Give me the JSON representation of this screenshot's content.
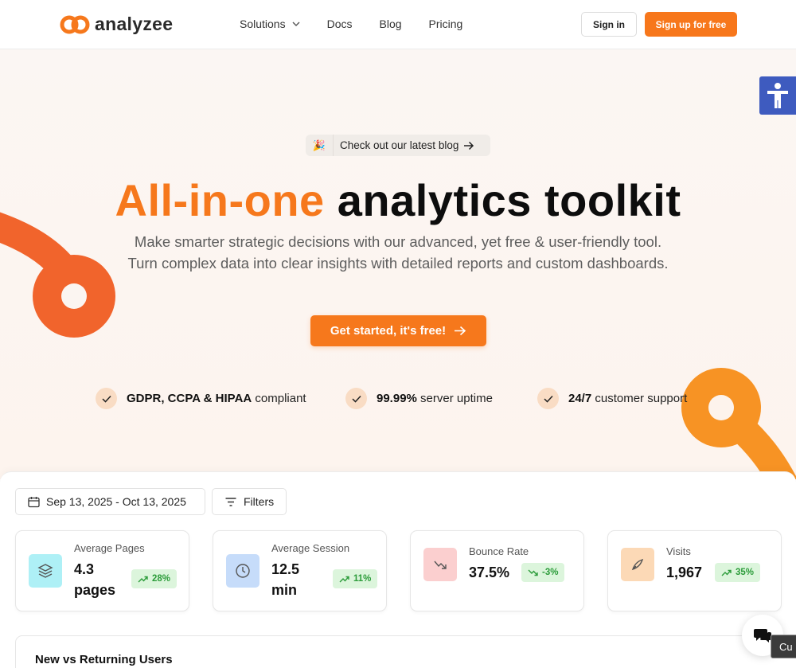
{
  "brand": {
    "name": "analyzee",
    "accent": "#f6781c"
  },
  "nav": {
    "items": [
      "Solutions",
      "Docs",
      "Blog",
      "Pricing"
    ]
  },
  "auth": {
    "sign_in": "Sign in",
    "sign_up": "Sign up for free"
  },
  "hero": {
    "pill_emoji": "🎉",
    "pill_text": "Check out our latest blog",
    "headline_accent": "All-in-one",
    "headline_rest": "analytics toolkit",
    "subtitle_line1": "Make smarter strategic decisions with our advanced, yet free & user-friendly tool.",
    "subtitle_line2": "Turn complex data into clear insights with detailed reports and custom dashboards.",
    "cta": "Get started, it's free!",
    "features": [
      {
        "bold": "GDPR, CCPA & HIPAA",
        "rest": " compliant"
      },
      {
        "bold": "99.99%",
        "rest": " server uptime"
      },
      {
        "bold": "24/7",
        "rest": " customer support"
      }
    ]
  },
  "dashboard": {
    "date_range": "Sep 13, 2025 - Oct 13, 2025",
    "filters_label": "Filters",
    "cards": [
      {
        "label": "Average Pages",
        "value_line1": "4.3",
        "value_line2": "pages",
        "change": "28%",
        "trend": "up",
        "icon": "layers-icon",
        "icon_bg": "#aef0f6"
      },
      {
        "label": "Average Session",
        "value_line1": "12.5",
        "value_line2": "min",
        "change": "11%",
        "trend": "up",
        "icon": "clock-icon",
        "icon_bg": "#c6dcfa"
      },
      {
        "label": "Bounce Rate",
        "value_line1": "37.5%",
        "value_line2": "",
        "change": "-3%",
        "trend": "down",
        "icon": "bounce-arrow-icon",
        "icon_bg": "#fbcfcf"
      },
      {
        "label": "Visits",
        "value_line1": "1,967",
        "value_line2": "",
        "change": "35%",
        "trend": "up",
        "icon": "footprint-icon",
        "icon_bg": "#fcd9b6"
      }
    ],
    "users_title": "New vs Returning Users"
  },
  "chat": {
    "tooltip": "Cu"
  }
}
